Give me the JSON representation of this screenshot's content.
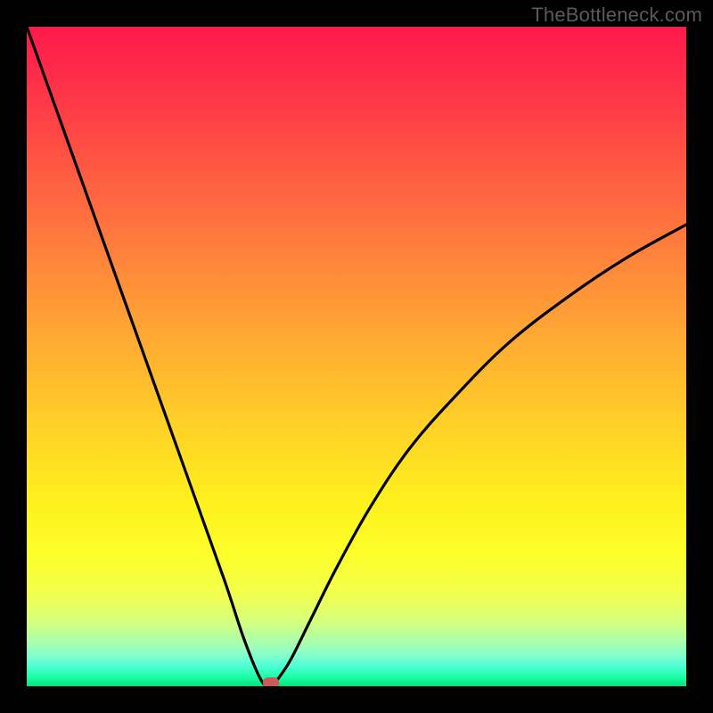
{
  "watermark": "TheBottleneck.com",
  "colors": {
    "gradient_top": "#ff1a4b",
    "gradient_mid": "#fff01c",
    "gradient_bottom": "#00e37a",
    "curve": "#000000",
    "frame_bg": "#000000",
    "watermark_text": "#5a5a5a",
    "marker": "#c85a5a"
  },
  "chart_data": {
    "type": "line",
    "title": "",
    "xlabel": "",
    "ylabel": "",
    "xlim": [
      0,
      100
    ],
    "ylim": [
      0,
      100
    ],
    "grid": false,
    "legend": false,
    "series": [
      {
        "name": "bottleneck-curve",
        "x": [
          0,
          5,
          10,
          15,
          20,
          25,
          30,
          33,
          35.5,
          37,
          38,
          40,
          43,
          47,
          52,
          58,
          65,
          73,
          82,
          91,
          100
        ],
        "y": [
          100,
          86,
          72,
          58,
          44,
          30,
          16,
          7,
          1,
          0,
          1,
          4,
          10,
          18,
          27,
          36,
          44,
          52,
          59,
          65,
          70
        ]
      }
    ],
    "annotations": [
      {
        "name": "minimum-marker",
        "x": 37,
        "y": 0
      }
    ],
    "notes": "y-axis is inverted visually (0 at bottom = green/good, 100 at top = red/bad). Values estimated from pixel positions."
  }
}
